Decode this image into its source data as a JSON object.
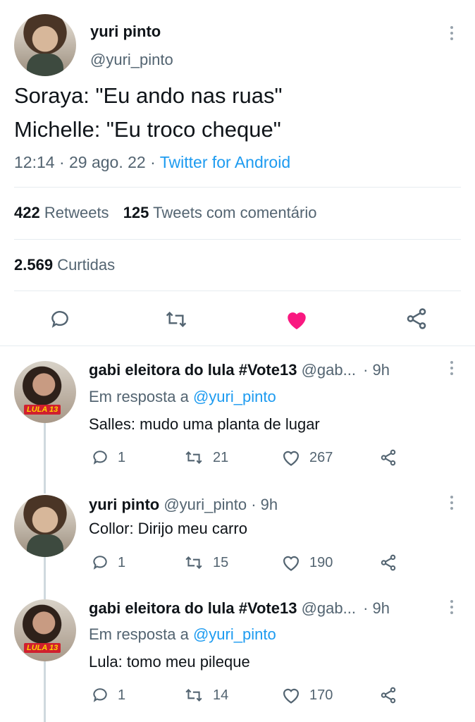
{
  "main_tweet": {
    "display_name": "yuri pinto",
    "handle": "@yuri_pinto",
    "text_line1": "Soraya: \"Eu ando nas ruas\"",
    "text_line2": "Michelle: \"Eu troco cheque\"",
    "time": "12:14 · 29 ago. 22 ·",
    "source": "Twitter for Android",
    "retweets_count": "422",
    "retweets_label": "Retweets",
    "quotes_count": "125",
    "quotes_label": "Tweets com comentário",
    "likes_count": "2.569",
    "likes_label": "Curtidas",
    "liked": true
  },
  "replies": [
    {
      "display_name": "gabi eleitora do lula #Vote13",
      "handle": "@gab...",
      "time": "· 9h",
      "reply_prefix": "Em resposta a",
      "reply_to": "@yuri_pinto",
      "text": "Salles: mudo uma planta de lugar",
      "replies": "1",
      "retweets": "21",
      "likes": "267",
      "avatar_badge": "LULA 13"
    },
    {
      "display_name": "yuri pinto",
      "handle": "@yuri_pinto",
      "time": "· 9h",
      "text": "Collor: Dirijo meu carro",
      "replies": "1",
      "retweets": "15",
      "likes": "190"
    },
    {
      "display_name": "gabi eleitora do lula #Vote13",
      "handle": "@gab...",
      "time": "· 9h",
      "reply_prefix": "Em resposta a",
      "reply_to": "@yuri_pinto",
      "text": "Lula: tomo meu pileque",
      "replies": "1",
      "retweets": "14",
      "likes": "170",
      "avatar_badge": "LULA 13"
    }
  ],
  "colors": {
    "like_active": "#f91880",
    "link": "#1d9bf0",
    "muted": "#536471"
  }
}
